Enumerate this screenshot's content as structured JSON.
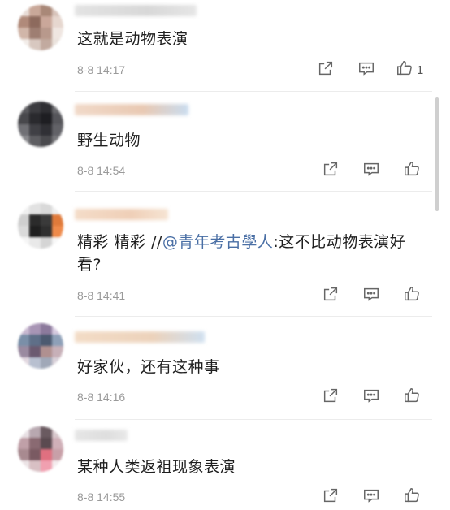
{
  "comments": [
    {
      "text": "这就是动物表演",
      "time": "8-8 14:17",
      "likes": "1",
      "avatar_colors": [
        "#e8dcd6",
        "#c9a899",
        "#a98878",
        "#d7c3ba",
        "#b08a7a",
        "#8d6a5d",
        "#caa79a",
        "#e6d7cf",
        "#d1b6a9",
        "#9e7e72",
        "#b8998c",
        "#efe6e1",
        "#f2ece8",
        "#d8c8c0",
        "#c2aa9f",
        "#eae2dc"
      ],
      "name_colors": [
        "#e3e3e3",
        "#d8d8d8",
        "#e6e6e6"
      ]
    },
    {
      "text": "野生动物",
      "time": "8-8 14:54",
      "likes": "",
      "avatar_colors": [
        "#5a5a5e",
        "#3c3c40",
        "#2f2f33",
        "#6b6b6f",
        "#48484c",
        "#2a2a2e",
        "#1e1e22",
        "#55555a",
        "#707075",
        "#404045",
        "#303035",
        "#626267",
        "#8a8a8e",
        "#5e5e62",
        "#4a4a4e",
        "#76767a"
      ],
      "name_colors": [
        "#f1d9c8",
        "#e9c9b3",
        "#c9dcef"
      ]
    },
    {
      "text_before": "精彩 精彩 //",
      "mention": "@青年考古學人",
      "text_after": ":这不比动物表演好看?",
      "time": "8-8 14:41",
      "likes": "",
      "avatar_colors": [
        "#f0f0f0",
        "#e2e2e2",
        "#d9d9d9",
        "#efefef",
        "#cfcfcf",
        "#2b2b2b",
        "#3a3a3a",
        "#e07a3a",
        "#dadada",
        "#1f1f1f",
        "#2f2f2f",
        "#ef8a4a",
        "#f5f5f5",
        "#e9e9e9",
        "#d5d5d5",
        "#f7f7f7"
      ],
      "name_colors": [
        "#f4dcc8",
        "#efcfb7",
        "#f6e4d3"
      ]
    },
    {
      "text": "好家伙，还有这种事",
      "time": "8-8 14:16",
      "likes": "",
      "avatar_colors": [
        "#c8b8d0",
        "#a895b5",
        "#8c7a9c",
        "#d6cadf",
        "#7a8fa8",
        "#5f6f88",
        "#4c5a70",
        "#8ea0b8",
        "#9a8aa0",
        "#6b5a70",
        "#b09090",
        "#c7b0b8",
        "#e2d8e0",
        "#b8c0d0",
        "#a0a8b8",
        "#d8d0d8"
      ],
      "name_colors": [
        "#f3dcc6",
        "#ecd2bb",
        "#cfe0f0"
      ]
    },
    {
      "text": "某种人类返祖现象表演",
      "time": "8-8 14:55",
      "likes": "",
      "avatar_colors": [
        "#e8e0e4",
        "#b8a8b0",
        "#6a5a60",
        "#d8c8cc",
        "#c0a0a8",
        "#8a6a72",
        "#5a4a50",
        "#d0b0b8",
        "#a88a90",
        "#7a5a62",
        "#e07080",
        "#c8a0a8",
        "#ece4e6",
        "#d8c0c4",
        "#f0a0b0",
        "#f4ecee"
      ],
      "name_colors": [
        "#e6e6e6",
        "#dedede",
        "#e8e8e8"
      ]
    }
  ],
  "icons": {
    "repost": "share-icon",
    "comment": "comment-icon",
    "like": "thumbs-up-icon"
  }
}
